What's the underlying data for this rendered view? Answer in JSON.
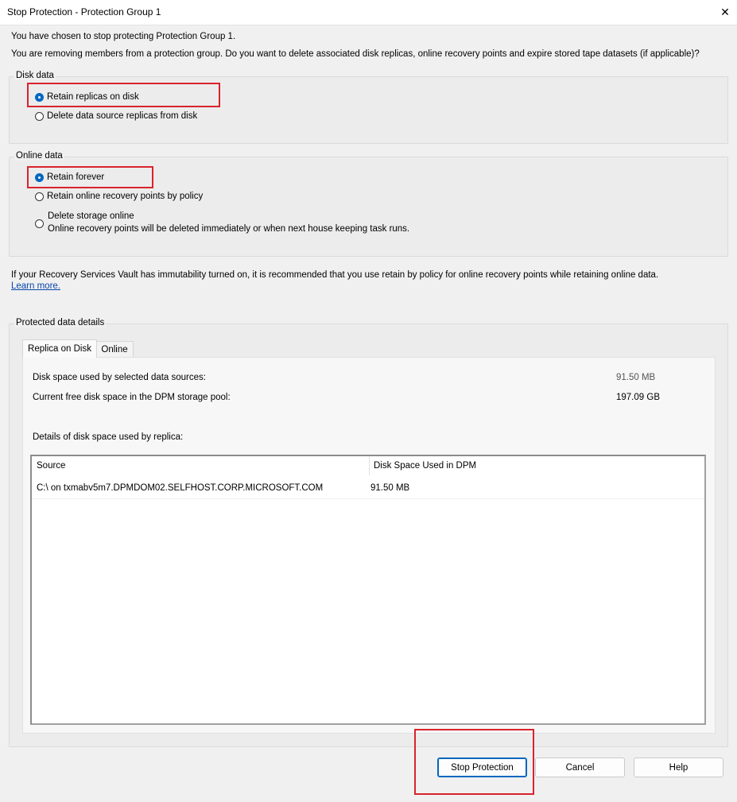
{
  "window": {
    "title": "Stop Protection - Protection Group 1",
    "close_glyph": "✕"
  },
  "intro": {
    "line1": "You have chosen to stop protecting Protection Group 1.",
    "line2": "You are removing members from a protection group. Do you want to delete associated disk replicas, online recovery points and expire stored tape datasets (if applicable)?"
  },
  "disk_data": {
    "label": "Disk data",
    "options": [
      {
        "label": "Retain replicas on disk",
        "checked": true
      },
      {
        "label": "Delete data source replicas from disk",
        "checked": false
      }
    ]
  },
  "online_data": {
    "label": "Online data",
    "options": [
      {
        "label": "Retain forever",
        "checked": true
      },
      {
        "label": "Retain online recovery points by policy",
        "checked": false
      },
      {
        "label": "Delete storage online",
        "sublabel": "Online recovery points will be deleted immediately or when next house keeping task runs.",
        "checked": false
      }
    ]
  },
  "immutability_note": {
    "text": "If your Recovery Services Vault has immutability turned on, it is recommended that you use retain by policy for online recovery points while retaining online data.",
    "link": "Learn more."
  },
  "protected_details": {
    "label": "Protected data details",
    "tabs": [
      {
        "label": "Replica on Disk",
        "active": true
      },
      {
        "label": "Online",
        "active": false
      }
    ],
    "disk_used_label": "Disk space used by selected data sources:",
    "disk_used_value": "91.50 MB",
    "free_space_label": "Current free disk space in the DPM storage pool:",
    "free_space_value": "197.09 GB",
    "details_label": "Details of disk space used by replica:",
    "table": {
      "columns": [
        "Source",
        "Disk Space Used in DPM"
      ],
      "rows": [
        [
          "C:\\ on txmabv5m7.DPMDOM02.SELFHOST.CORP.MICROSOFT.COM",
          "91.50 MB"
        ]
      ]
    }
  },
  "buttons": {
    "stop": "Stop Protection",
    "cancel": "Cancel",
    "help": "Help"
  },
  "colors": {
    "highlight": "#d9232d",
    "accent": "#0067c0"
  }
}
